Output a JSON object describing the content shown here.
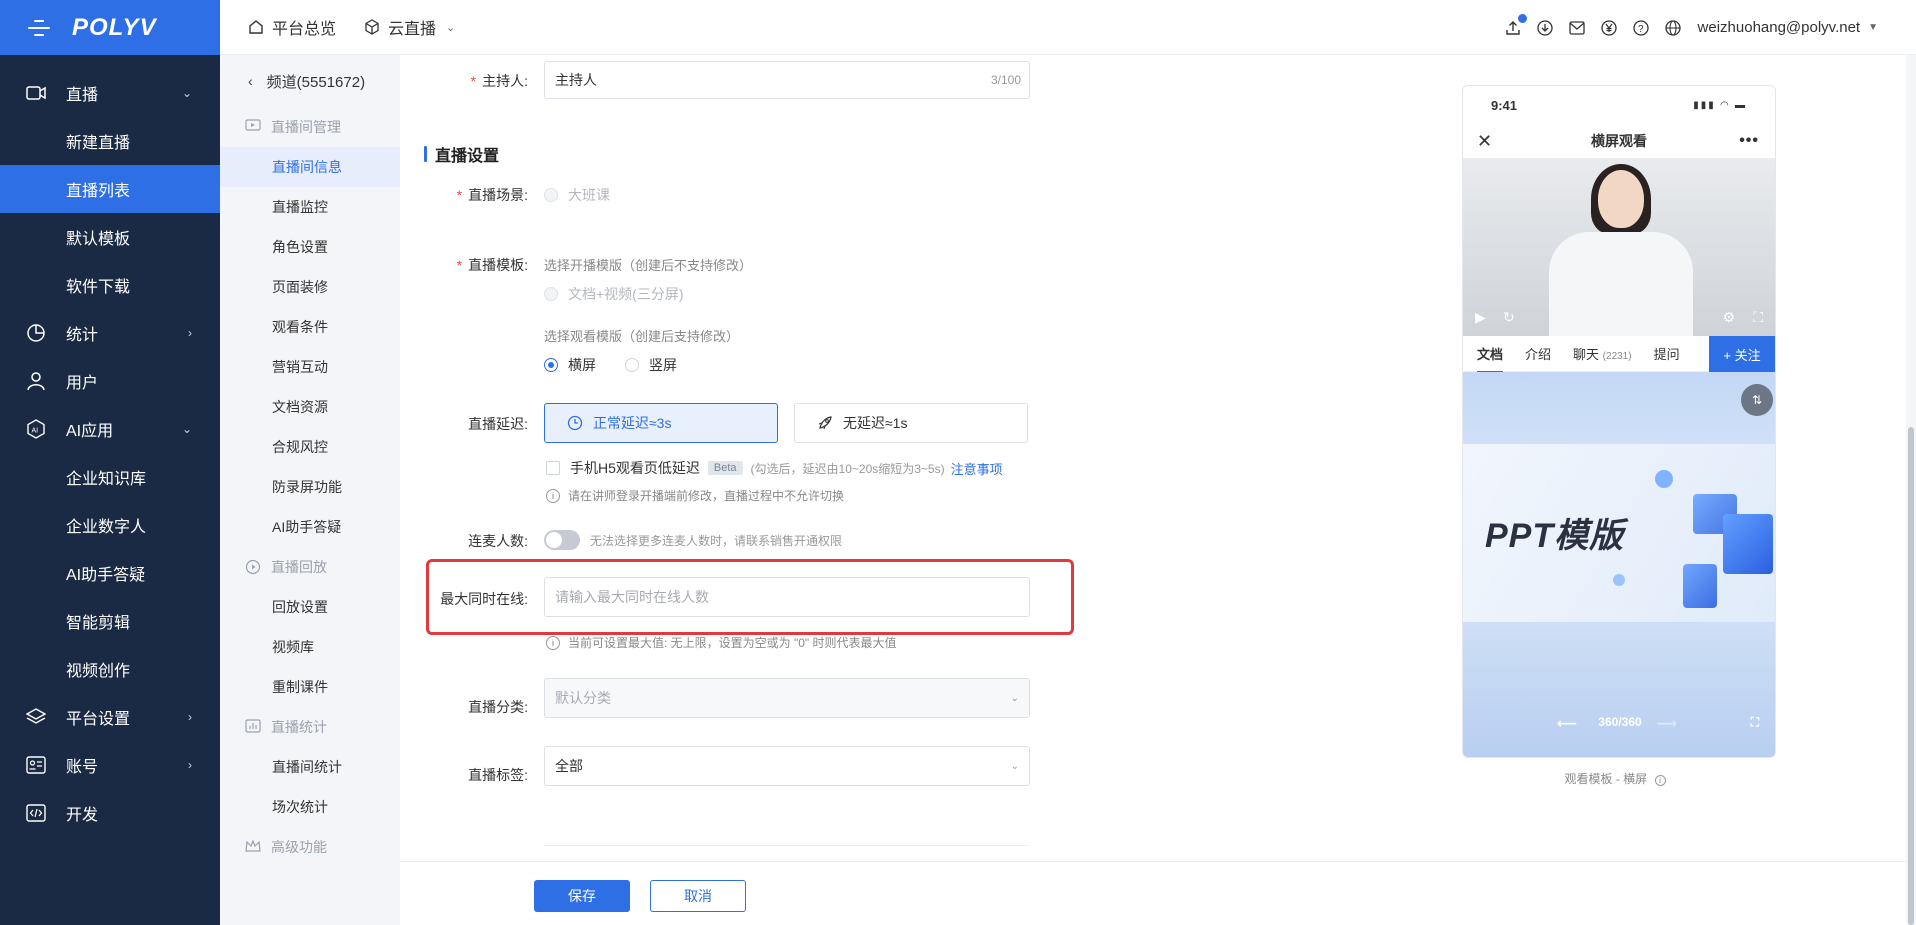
{
  "brand": {
    "logo": "POLYV"
  },
  "left_nav": {
    "items": [
      {
        "label": "直播",
        "icon": "video-icon",
        "chevron": "⌄",
        "sub": [
          "新建直播",
          "直播列表",
          "默认模板",
          "软件下载"
        ]
      },
      {
        "label": "统计",
        "icon": "chart-icon",
        "chevron": "›"
      },
      {
        "label": "用户",
        "icon": "user-icon",
        "chevron": ""
      },
      {
        "label": "AI应用",
        "icon": "ai-icon",
        "chevron": "⌄",
        "sub": [
          "企业知识库",
          "企业数字人",
          "AI助手答疑",
          "智能剪辑",
          "视频创作"
        ]
      },
      {
        "label": "平台设置",
        "icon": "layers-icon",
        "chevron": "›"
      },
      {
        "label": "账号",
        "icon": "id-card-icon",
        "chevron": "›"
      },
      {
        "label": "开发",
        "icon": "code-icon",
        "chevron": ""
      }
    ],
    "active_sub": "直播列表"
  },
  "topbar": {
    "links": [
      {
        "label": "平台总览",
        "icon": "home-icon"
      },
      {
        "label": "云直播",
        "icon": "cube-icon",
        "dropdown": true
      }
    ],
    "user": "weizhuohang@polyv.net",
    "right_icons": [
      "upload-icon",
      "download-icon",
      "mail-icon",
      "yen-icon",
      "help-icon",
      "globe-icon"
    ]
  },
  "subnav": {
    "back_label": "频道(5551672)",
    "groups": [
      {
        "title": "直播间管理",
        "items": [
          "直播间信息",
          "直播监控",
          "角色设置",
          "页面装修",
          "观看条件",
          "营销互动",
          "文档资源",
          "合规风控",
          "防录屏功能",
          "AI助手答疑"
        ]
      },
      {
        "title": "直播回放",
        "items": [
          "回放设置",
          "视频库",
          "重制课件"
        ]
      },
      {
        "title": "直播统计",
        "items": [
          "直播间统计",
          "场次统计"
        ]
      },
      {
        "title": "高级功能",
        "items": []
      }
    ],
    "active_item": "直播间信息"
  },
  "form": {
    "host": {
      "label": "主持人:",
      "value": "主持人",
      "count": "3/100"
    },
    "section_title": "直播设置",
    "scene": {
      "label": "直播场景:",
      "option": "大班课"
    },
    "template": {
      "label": "直播模板:",
      "broadcast_hint": "选择开播模版（创建后不支持修改）",
      "broadcast_option": "文档+视频(三分屏)",
      "watch_hint": "选择观看模版（创建后支持修改）",
      "watch_options": [
        "横屏",
        "竖屏"
      ]
    },
    "delay": {
      "label": "直播延迟:",
      "options": [
        "正常延迟≈3s",
        "无延迟≈1s"
      ],
      "h5_checkbox": "手机H5观看页低延迟",
      "beta": "Beta",
      "h5_note": "(勾选后，延迟由10~20s缩短为3~5s)",
      "h5_link": "注意事项",
      "info": "请在讲师登录开播端前修改，直播过程中不允许切换"
    },
    "mic": {
      "label": "连麦人数:",
      "note": "无法选择更多连麦人数时，请联系销售开通权限"
    },
    "max_online": {
      "label": "最大同时在线:",
      "placeholder": "请输入最大同时在线人数",
      "hint": "当前可设置最大值: 无上限，设置为空或为 \"0\" 时则代表最大值"
    },
    "category": {
      "label": "直播分类:",
      "value": "默认分类"
    },
    "tag": {
      "label": "直播标签:",
      "value": "全部"
    }
  },
  "footer": {
    "save": "保存",
    "cancel": "取消"
  },
  "preview": {
    "time": "9:41",
    "title": "横屏观看",
    "tabs": [
      {
        "label": "文档",
        "extra": ""
      },
      {
        "label": "介绍",
        "extra": ""
      },
      {
        "label": "聊天",
        "extra": "(2231)"
      },
      {
        "label": "提问",
        "extra": ""
      }
    ],
    "follow": "+ 关注",
    "slide_text": "PPT模版",
    "pager": "360/360",
    "caption": "观看模板 - 横屏"
  }
}
